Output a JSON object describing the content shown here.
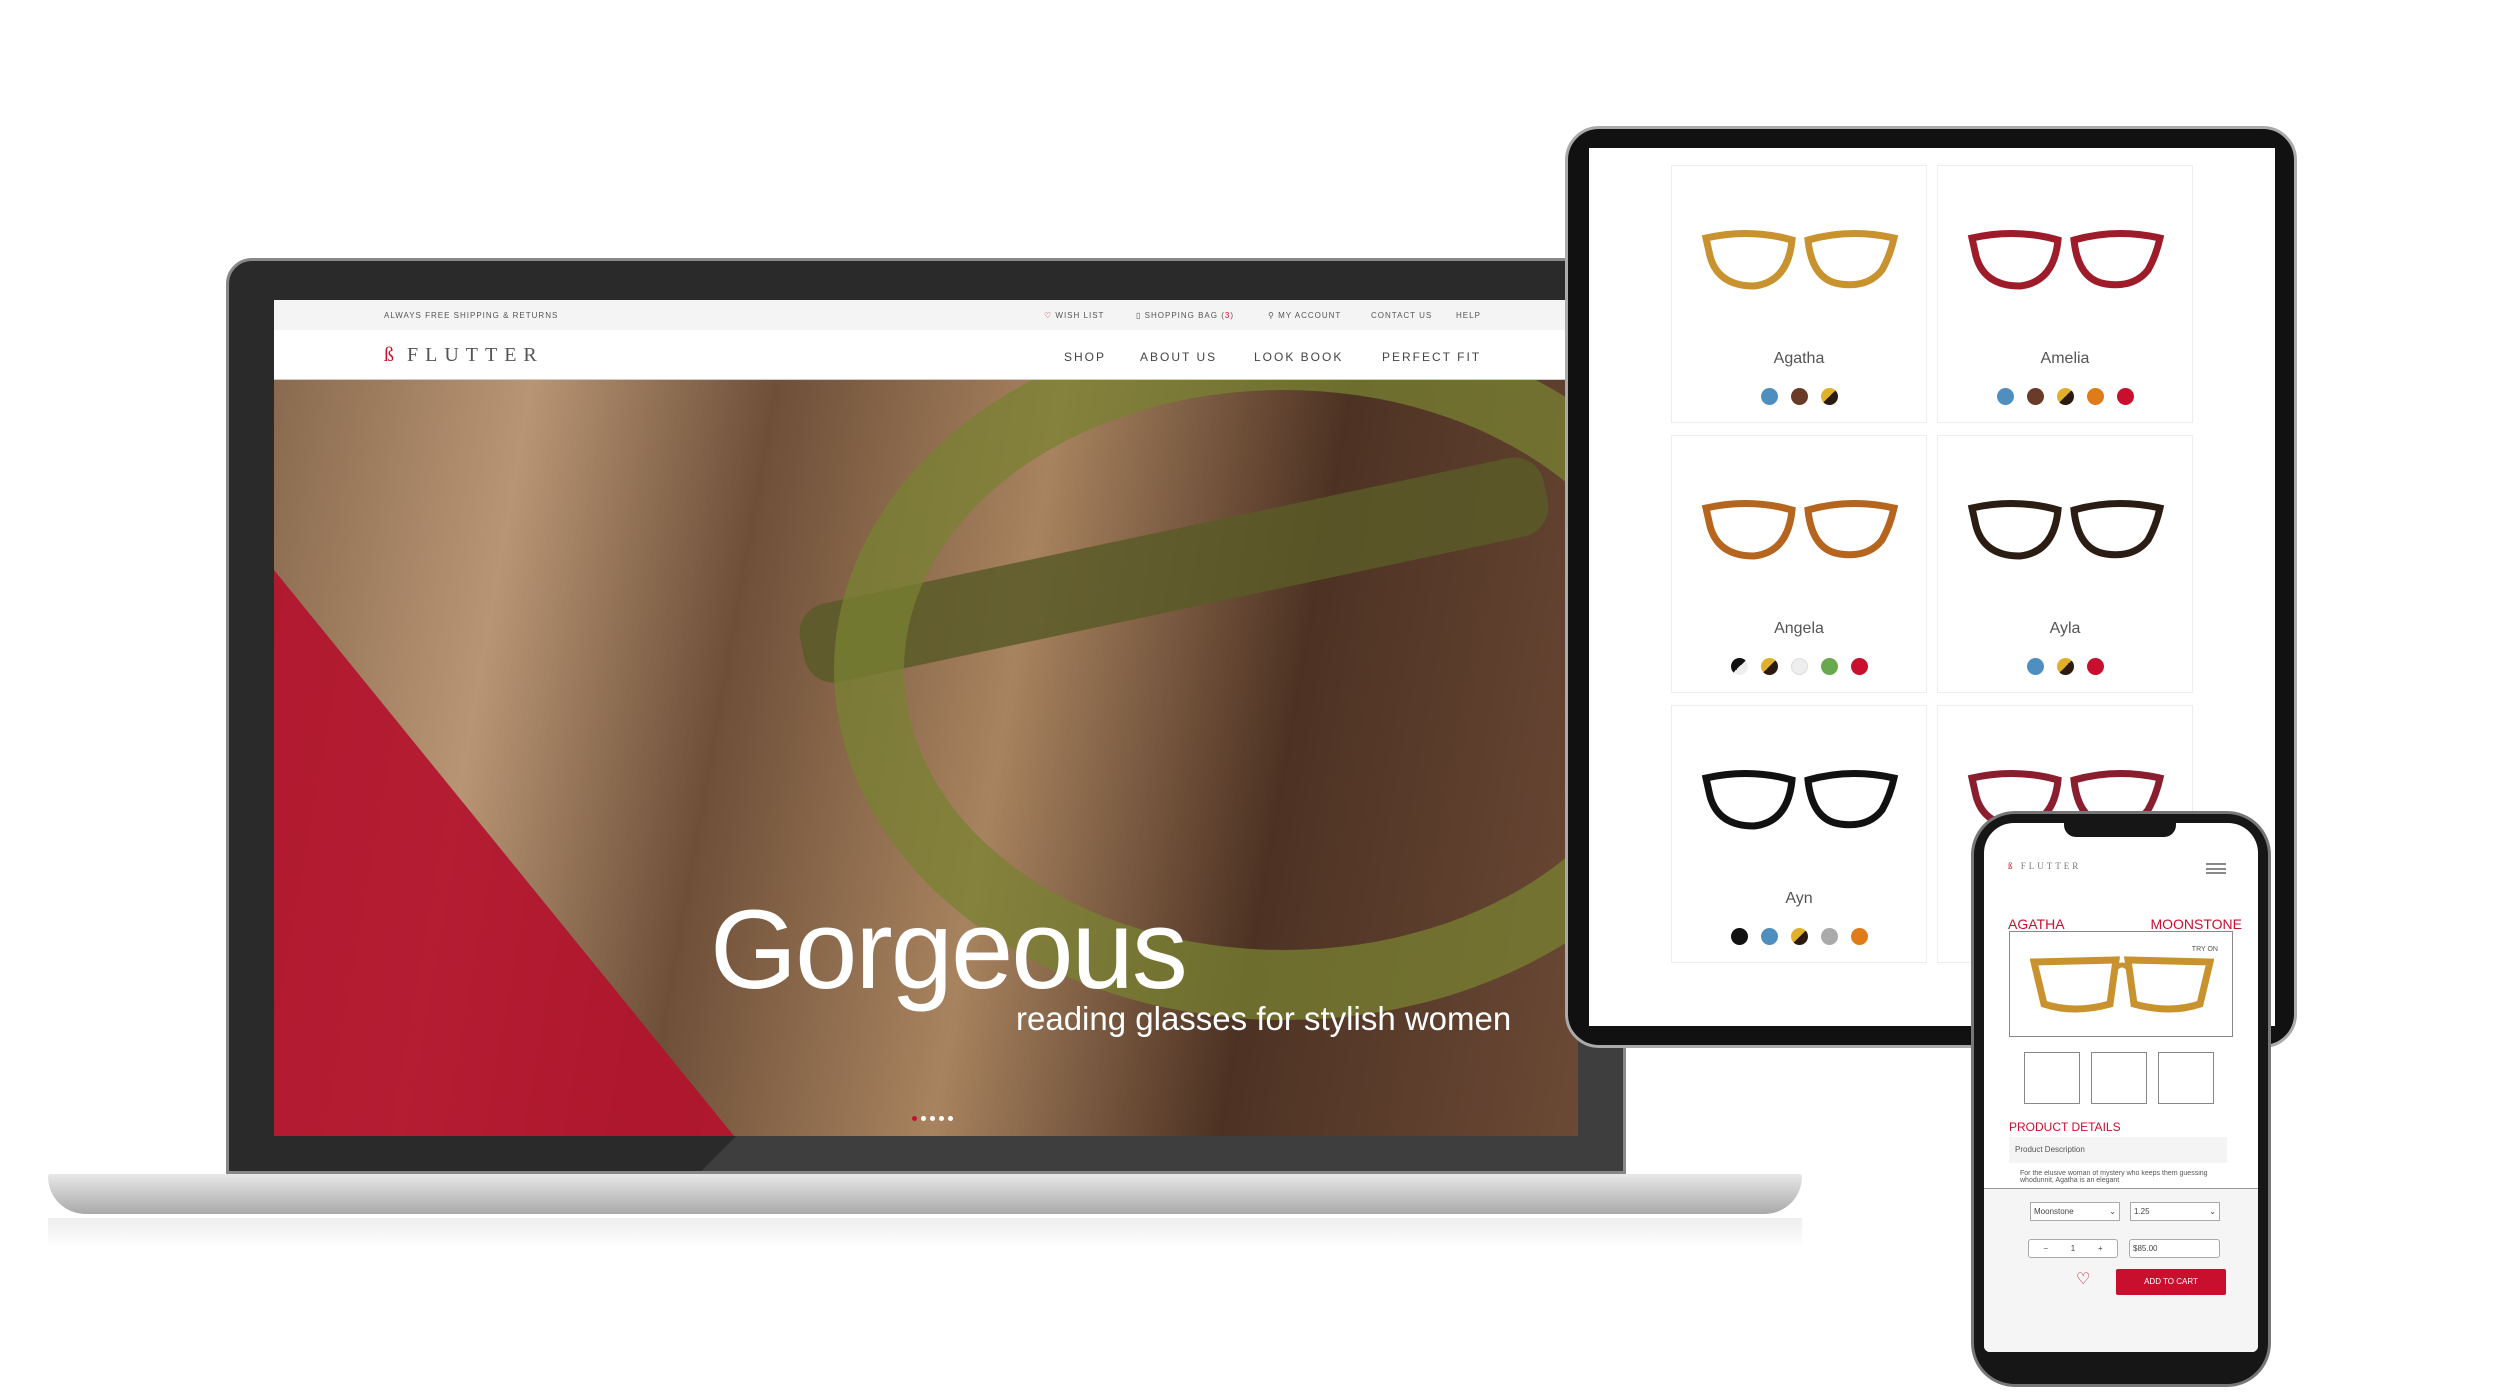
{
  "laptop": {
    "topbar": {
      "shipping": "ALWAYS FREE SHIPPING & RETURNS",
      "wish_list": "WISH LIST",
      "shopping_bag": "SHOPPING BAG",
      "bag_count": "3",
      "my_account": "MY ACCOUNT",
      "contact": "CONTACT US",
      "help": "HELP"
    },
    "logo": "FLUTTER",
    "nav": [
      "SHOP",
      "ABOUT US",
      "LOOK BOOK",
      "PERFECT FIT"
    ],
    "hero": {
      "title": "Gorgeous",
      "subtitle": "reading glasses for stylish women",
      "slides": 5,
      "active_slide": 1
    }
  },
  "tablet": {
    "products": [
      {
        "name": "Agatha",
        "frame": "#c8922e",
        "swatches": [
          "#4f8fc0",
          "#6b3b2a",
          "tortoise"
        ]
      },
      {
        "name": "Amelia",
        "frame": "#9e1b2a",
        "swatches": [
          "#4f8fc0",
          "#6b3b2a",
          "tortoise",
          "#e07b1a",
          "#c8102e"
        ]
      },
      {
        "name": "Angela",
        "frame": "#b5651d",
        "swatches": [
          "bw",
          "tortoise",
          "#eeeeee",
          "#6aa84f",
          "#c8102e"
        ]
      },
      {
        "name": "Ayla",
        "frame": "#2b1d14",
        "swatches": [
          "#4f8fc0",
          "tortoise",
          "#c8102e"
        ]
      },
      {
        "name": "Ayn",
        "frame": "#111111",
        "swatches": [
          "#111111",
          "#4f8fc0",
          "tortoise",
          "#aaaaaa",
          "#e07b1a"
        ]
      },
      {
        "name": "",
        "frame": "#8a1e2e",
        "swatches": []
      }
    ]
  },
  "phone": {
    "logo": "FLUTTER",
    "product": "AGATHA",
    "color": "MOONSTONE",
    "try_on": "TRY ON",
    "details_title": "PRODUCT DETAILS",
    "description_tab": "Product Description",
    "description": "For the elusive woman of mystery who keeps them guessing whodunnit, Agatha is an elegant",
    "color_select": "Moonstone",
    "power_select": "1.25",
    "quantity": "1",
    "price": "$85.00",
    "add_to_cart": "ADD TO CART"
  },
  "colors": {
    "accent": "#c8102e"
  }
}
